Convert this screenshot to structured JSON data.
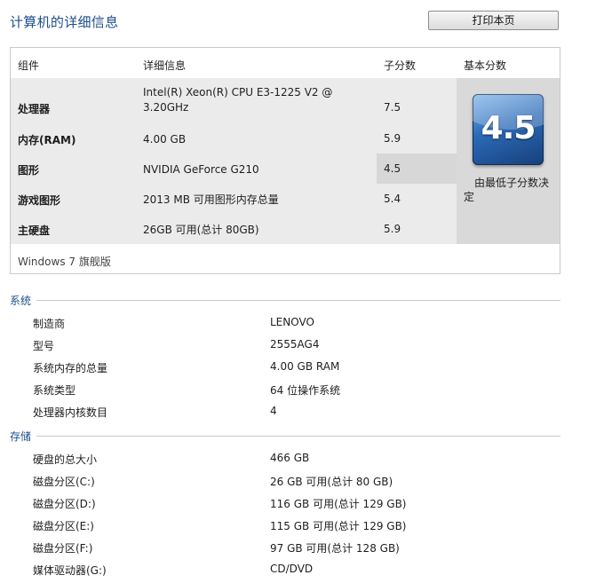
{
  "page_title": "计算机的详细信息",
  "print_button": "打印本页",
  "score_table": {
    "headers": [
      "组件",
      "详细信息",
      "子分数",
      "基本分数"
    ],
    "rows": [
      {
        "component": "处理器",
        "details_line1": "Intel(R) Xeon(R) CPU E3-1225 V2 @",
        "details_line2": "3.20GHz",
        "subscore": "7.5"
      },
      {
        "component": "内存(RAM)",
        "details_line1": "4.00 GB",
        "subscore": "5.9"
      },
      {
        "component": "图形",
        "details_line1": "NVIDIA GeForce G210",
        "subscore": "4.5"
      },
      {
        "component": "游戏图形",
        "details_line1": "2013 MB 可用图形内存总量",
        "subscore": "5.4"
      },
      {
        "component": "主硬盘",
        "details_line1": "26GB 可用(总计 80GB)",
        "subscore": "5.9"
      }
    ],
    "base_score": "4.5",
    "base_score_note": "由最低子分数决定",
    "windows_edition": "Windows 7 旗舰版"
  },
  "system": {
    "title": "系统",
    "items": [
      {
        "label": "制造商",
        "value": "LENOVO"
      },
      {
        "label": "型号",
        "value": "2555AG4"
      },
      {
        "label": "系统内存的总量",
        "value": "4.00 GB RAM"
      },
      {
        "label": "系统类型",
        "value": "64 位操作系统"
      },
      {
        "label": "处理器内核数目",
        "value": "4"
      }
    ]
  },
  "storage": {
    "title": "存储",
    "items": [
      {
        "label": "硬盘的总大小",
        "value": "466 GB"
      },
      {
        "label": "磁盘分区(C:)",
        "value": "26 GB 可用(总计 80 GB)"
      },
      {
        "label": "磁盘分区(D:)",
        "value": "116 GB 可用(总计 129 GB)"
      },
      {
        "label": "磁盘分区(E:)",
        "value": "115 GB 可用(总计 129 GB)"
      },
      {
        "label": "磁盘分区(F:)",
        "value": "97 GB 可用(总计 128 GB)"
      },
      {
        "label": "媒体驱动器(G:)",
        "value": "CD/DVD"
      }
    ]
  },
  "colors": {
    "title_blue": "#1e4e8c",
    "panel_gray": "#ebebeb",
    "lowest_highlight": "#d7d7d7"
  }
}
